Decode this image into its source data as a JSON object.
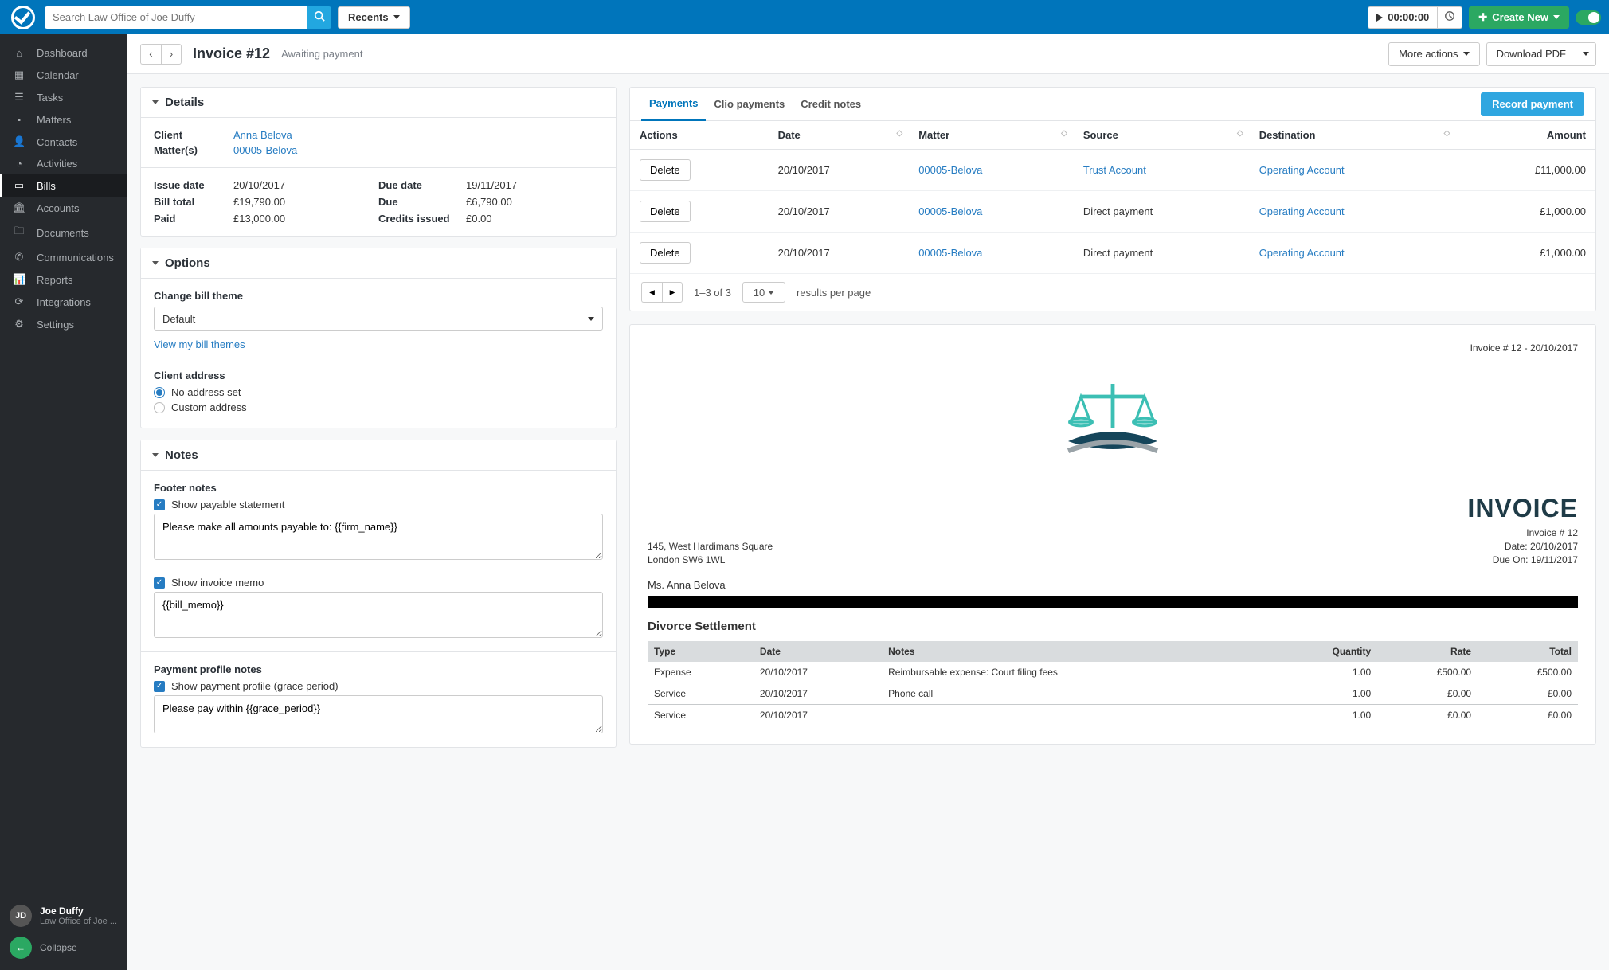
{
  "topbar": {
    "search_placeholder": "Search Law Office of Joe Duffy",
    "recents_label": "Recents",
    "timer": "00:00:00",
    "create_label": "Create New"
  },
  "sidebar": {
    "items": [
      {
        "label": "Dashboard"
      },
      {
        "label": "Calendar"
      },
      {
        "label": "Tasks"
      },
      {
        "label": "Matters"
      },
      {
        "label": "Contacts"
      },
      {
        "label": "Activities"
      },
      {
        "label": "Bills"
      },
      {
        "label": "Accounts"
      },
      {
        "label": "Documents"
      },
      {
        "label": "Communications"
      },
      {
        "label": "Reports"
      },
      {
        "label": "Integrations"
      },
      {
        "label": "Settings"
      }
    ],
    "user": {
      "initials": "JD",
      "name": "Joe Duffy",
      "firm": "Law Office of Joe ..."
    },
    "collapse_label": "Collapse"
  },
  "header": {
    "title": "Invoice #12",
    "status": "Awaiting payment",
    "more_actions": "More actions",
    "download_pdf": "Download PDF"
  },
  "details": {
    "section_title": "Details",
    "client_label": "Client",
    "client_value": "Anna Belova",
    "matters_label": "Matter(s)",
    "matters_value": "00005-Belova",
    "issue_date_label": "Issue date",
    "issue_date": "20/10/2017",
    "bill_total_label": "Bill total",
    "bill_total": "£19,790.00",
    "paid_label": "Paid",
    "paid": "£13,000.00",
    "due_date_label": "Due date",
    "due_date": "19/11/2017",
    "due_label": "Due",
    "due": "£6,790.00",
    "credits_label": "Credits issued",
    "credits": "£0.00"
  },
  "options": {
    "section_title": "Options",
    "theme_label": "Change bill theme",
    "theme_value": "Default",
    "view_themes_link": "View my bill themes",
    "client_address_label": "Client address",
    "no_address": "No address set",
    "custom_address": "Custom address"
  },
  "notes": {
    "section_title": "Notes",
    "footer_label": "Footer notes",
    "show_payable": "Show payable statement",
    "payable_text": "Please make all amounts payable to: {{firm_name}}",
    "show_memo": "Show invoice memo",
    "memo_text": "{{bill_memo}}",
    "profile_label": "Payment profile notes",
    "show_profile": "Show payment profile (grace period)",
    "profile_text": "Please pay within {{grace_period}}"
  },
  "payments_panel": {
    "tabs": {
      "payments": "Payments",
      "clio": "Clio payments",
      "credit": "Credit notes"
    },
    "record_btn": "Record payment",
    "columns": {
      "actions": "Actions",
      "date": "Date",
      "matter": "Matter",
      "source": "Source",
      "destination": "Destination",
      "amount": "Amount"
    },
    "rows": [
      {
        "date": "20/10/2017",
        "matter": "00005-Belova",
        "source": "Trust Account",
        "source_link": true,
        "destination": "Operating Account",
        "amount": "£11,000.00"
      },
      {
        "date": "20/10/2017",
        "matter": "00005-Belova",
        "source": "Direct payment",
        "source_link": false,
        "destination": "Operating Account",
        "amount": "£1,000.00"
      },
      {
        "date": "20/10/2017",
        "matter": "00005-Belova",
        "source": "Direct payment",
        "source_link": false,
        "destination": "Operating Account",
        "amount": "£1,000.00"
      }
    ],
    "delete_label": "Delete",
    "range": "1–3 of 3",
    "per_page_value": "10",
    "per_page_label": "results per page"
  },
  "invoice": {
    "topline": "Invoice # 12 - 20/10/2017",
    "addr1": "145, West Hardimans Square",
    "addr2": "London SW6 1WL",
    "title": "INVOICE",
    "meta1": "Invoice # 12",
    "meta2": "Date: 20/10/2017",
    "meta3": "Due On: 19/11/2017",
    "client": "Ms. Anna Belova",
    "matter": "Divorce Settlement",
    "columns": {
      "type": "Type",
      "date": "Date",
      "notes": "Notes",
      "qty": "Quantity",
      "rate": "Rate",
      "total": "Total"
    },
    "lines": [
      {
        "type": "Expense",
        "date": "20/10/2017",
        "notes": "Reimbursable expense: Court filing fees",
        "qty": "1.00",
        "rate": "£500.00",
        "total": "£500.00"
      },
      {
        "type": "Service",
        "date": "20/10/2017",
        "notes": "Phone call",
        "qty": "1.00",
        "rate": "£0.00",
        "total": "£0.00"
      },
      {
        "type": "Service",
        "date": "20/10/2017",
        "notes": "",
        "qty": "1.00",
        "rate": "£0.00",
        "total": "£0.00"
      }
    ]
  }
}
